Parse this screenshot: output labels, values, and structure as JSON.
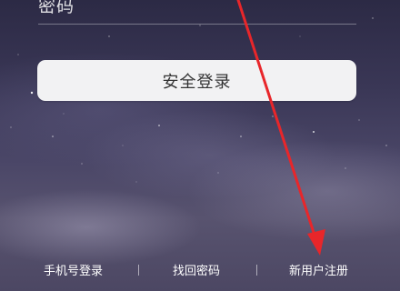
{
  "form": {
    "password_label": "密码",
    "login_button": "安全登录"
  },
  "footer": {
    "phone_login": "手机号登录",
    "separator": "|",
    "find_password": "找回密码",
    "register": "新用户注册"
  },
  "annotation": {
    "arrow_color": "#e8262a"
  },
  "colors": {
    "button_bg": "#f2f2f3",
    "text_white": "#ffffff"
  }
}
